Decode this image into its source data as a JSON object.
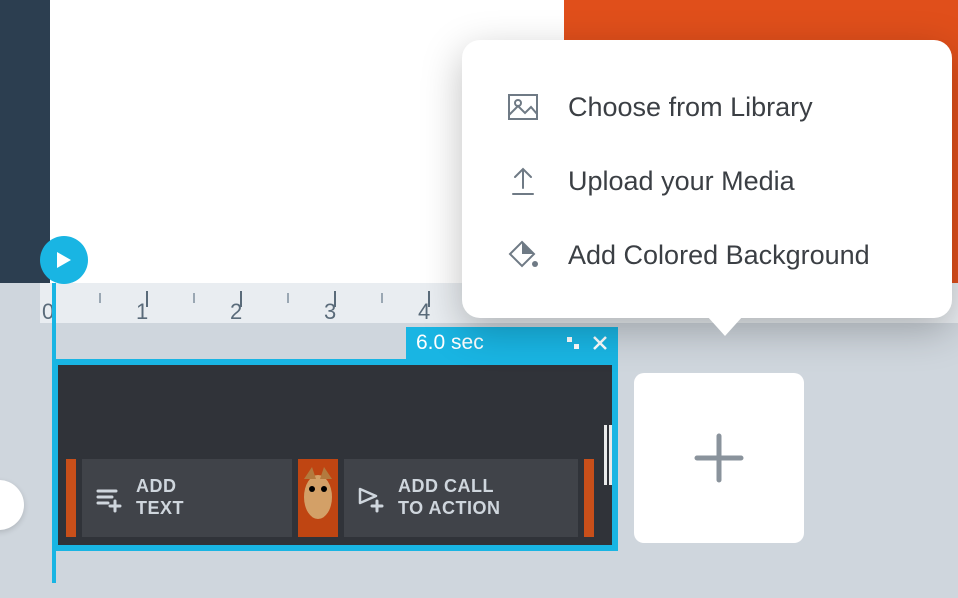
{
  "popover": {
    "items": [
      {
        "label": "Choose from Library"
      },
      {
        "label": "Upload your Media"
      },
      {
        "label": "Add Colored Background"
      }
    ]
  },
  "timeline": {
    "ruler_labels": [
      "0",
      "1",
      "2",
      "3",
      "4"
    ],
    "clip": {
      "duration_label": "6.0 sec",
      "add_text_label": "ADD TEXT",
      "add_cta_label": "ADD CALL TO ACTION"
    }
  }
}
